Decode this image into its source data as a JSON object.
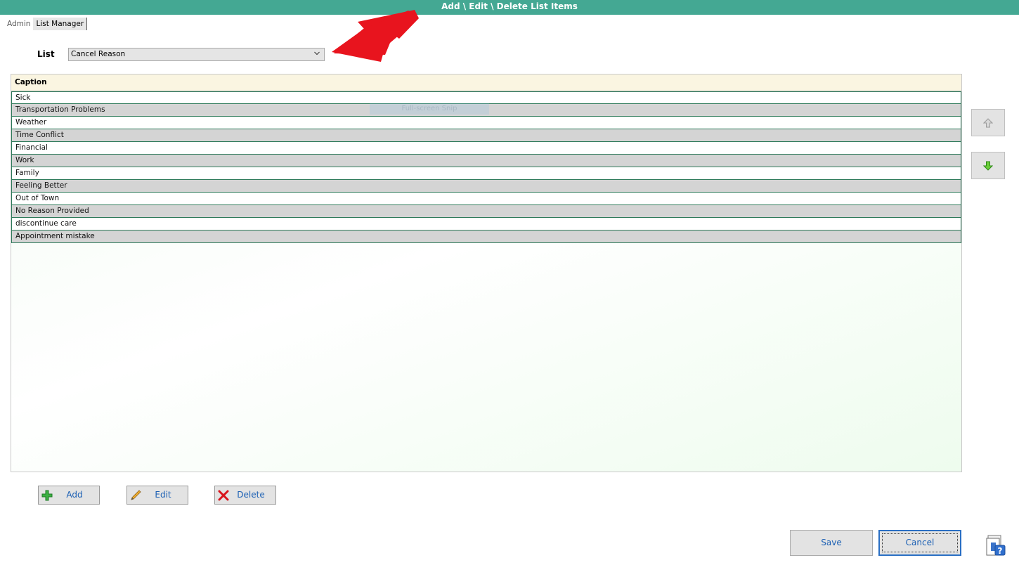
{
  "window": {
    "title": "Add \\ Edit \\ Delete List Items"
  },
  "breadcrumb": {
    "items": [
      "Admin",
      "List Manager"
    ]
  },
  "list_selector": {
    "label": "List",
    "selected": "Cancel Reason"
  },
  "grid": {
    "header": "Caption",
    "rows": [
      "Sick",
      "Transportation Problems",
      "Weather",
      "Time Conflict",
      "Financial",
      "Work",
      "Family",
      "Feeling Better",
      "Out of Town",
      "No Reason Provided",
      "discontinue care",
      "Appointment mistake"
    ]
  },
  "overlay": {
    "snip_text": "Full-screen Snip"
  },
  "actions": {
    "add_label": "Add",
    "edit_label": "Edit",
    "delete_label": "Delete"
  },
  "footer": {
    "save_label": "Save",
    "cancel_label": "Cancel"
  },
  "colors": {
    "titlebar": "#44a893",
    "link_text": "#1a5fb4",
    "arrow": "#e8141e",
    "row_alt": "#d4d4d4"
  },
  "icons": {
    "move_up": "arrow-up-icon",
    "move_down": "arrow-down-icon",
    "add": "plus-icon",
    "edit": "pencil-icon",
    "delete": "x-icon",
    "help": "help-icon"
  }
}
